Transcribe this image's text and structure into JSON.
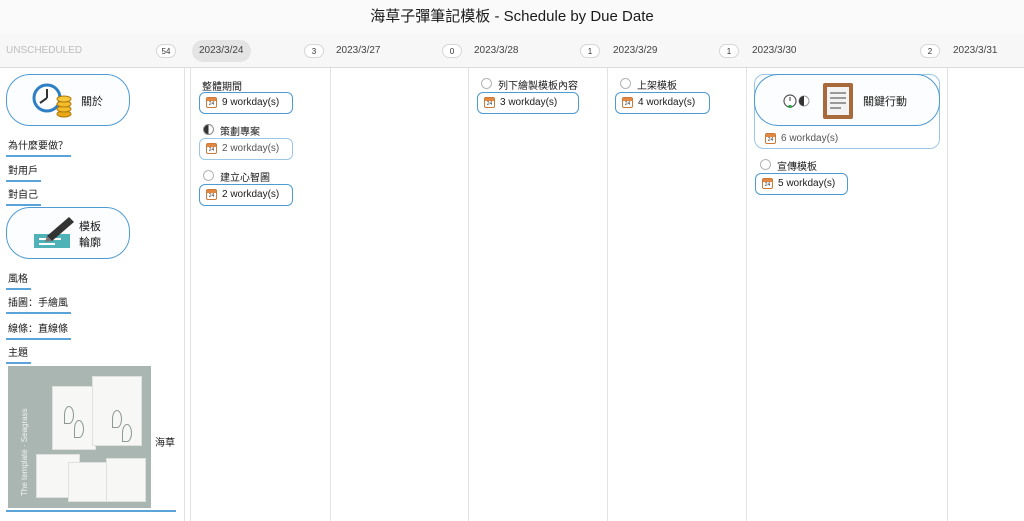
{
  "window_title": "海草子彈筆記模板 - Schedule by Due Date",
  "columns": [
    {
      "label": "UNSCHEDULED",
      "count": "54"
    },
    {
      "label": "2023/3/24",
      "count": "3"
    },
    {
      "label": "2023/3/27",
      "count": "0"
    },
    {
      "label": "2023/3/28",
      "count": "1"
    },
    {
      "label": "2023/3/29",
      "count": "1"
    },
    {
      "label": "2023/3/30",
      "count": "2"
    },
    {
      "label": "2023/3/31",
      "count": ""
    }
  ],
  "unscheduled": {
    "about_node": "關於",
    "about_items": [
      "為什麼要做？",
      "對用戶",
      "對自己"
    ],
    "outline_node_line1": "模板",
    "outline_node_line2": "輪廓",
    "outline_items": [
      "風格",
      "插圖：手繪風",
      "線條：直線條",
      "主題"
    ],
    "thumb_vertical_text": "The template · Seagrass",
    "thumb_caption": "海草"
  },
  "calendar_icon_day": "24",
  "tasks_0324": [
    {
      "title": "整體期間",
      "duration": "9 workday(s)"
    },
    {
      "title": "策劃專案",
      "duration": "2 workday(s)"
    },
    {
      "title": "建立心智圖",
      "duration": "2 workday(s)"
    }
  ],
  "tasks_0328": [
    {
      "title": "列下繪製模板內容",
      "duration": "3 workday(s)"
    }
  ],
  "tasks_0329": [
    {
      "title": "上架模板",
      "duration": "4 workday(s)"
    }
  ],
  "tasks_0330": {
    "key_action": "關鍵行動",
    "key_duration": "6 workday(s)",
    "promo_title": "宣傳模板",
    "promo_duration": "5 workday(s)"
  },
  "colors": {
    "accent": "#4e9ad3",
    "header_bg": "#f7f7f7",
    "calendar_orange": "#e2873f"
  }
}
